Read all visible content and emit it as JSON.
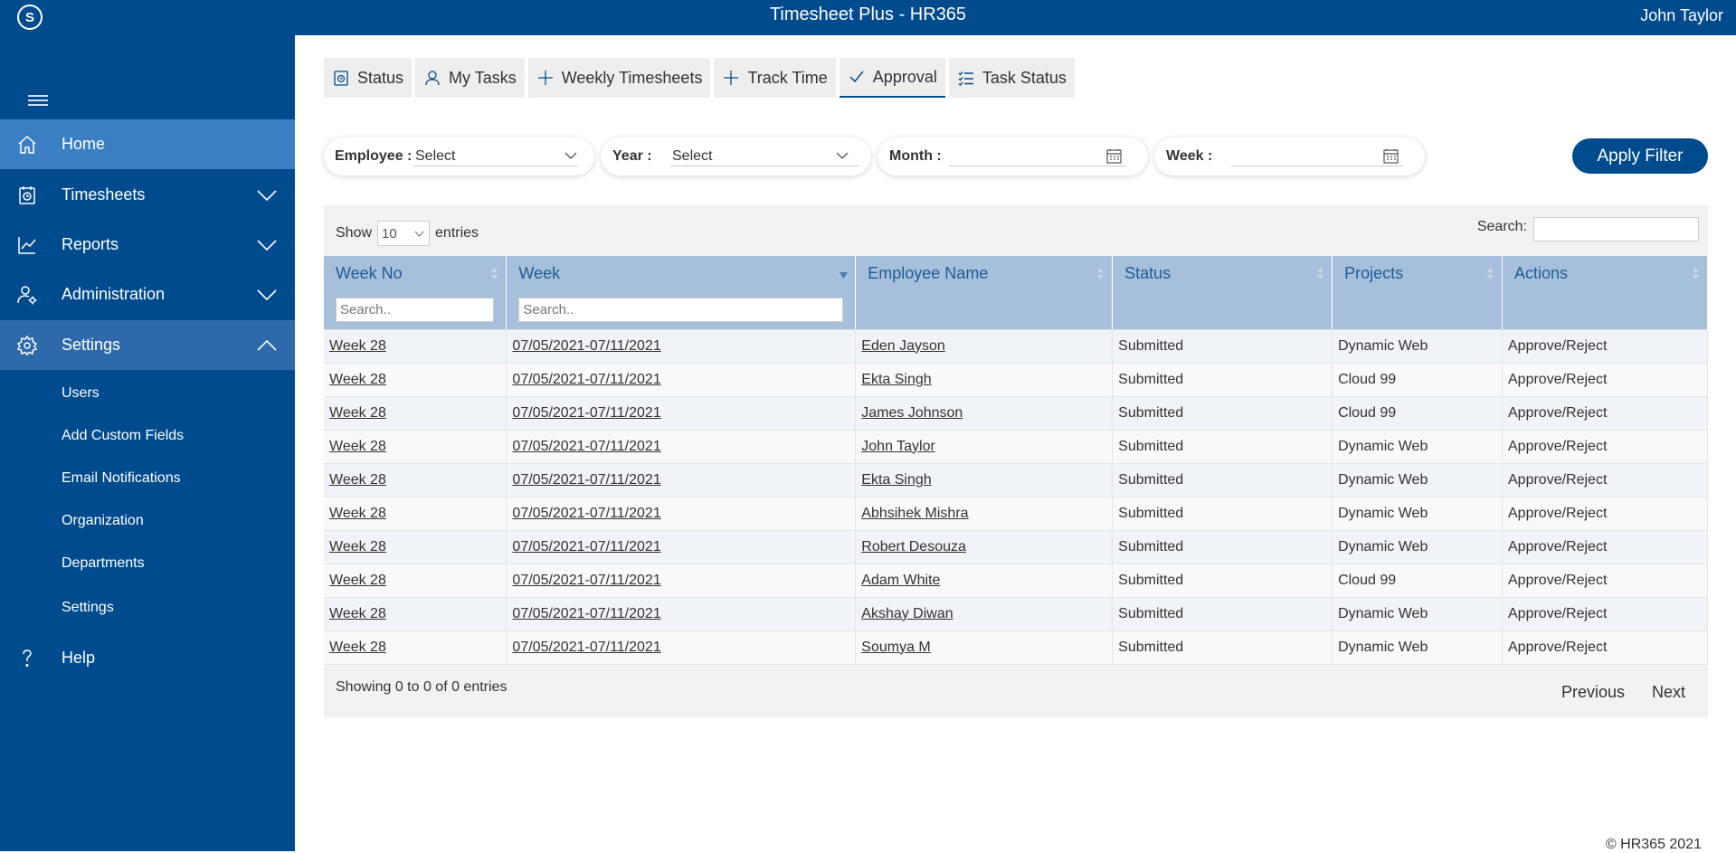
{
  "header": {
    "title": "Timesheet Plus - HR365",
    "user": "John Taylor",
    "logo_letter": "S"
  },
  "sidebar": {
    "items": [
      {
        "label": "Home",
        "icon": "home-icon"
      },
      {
        "label": "Timesheets",
        "icon": "timesheet-icon"
      },
      {
        "label": "Reports",
        "icon": "chart-icon"
      },
      {
        "label": "Administration",
        "icon": "admin-icon"
      },
      {
        "label": "Settings",
        "icon": "gear-icon"
      },
      {
        "label": "Help",
        "icon": "help-icon"
      }
    ],
    "settings_sub": [
      "Users",
      "Add Custom Fields",
      "Email Notifications",
      "Organization",
      "Departments",
      "Settings"
    ]
  },
  "tabs": [
    {
      "label": "Status",
      "icon": "status-icon"
    },
    {
      "label": "My Tasks",
      "icon": "user-icon"
    },
    {
      "label": "Weekly Timesheets",
      "icon": "plus-icon"
    },
    {
      "label": "Track Time",
      "icon": "plus-icon"
    },
    {
      "label": "Approval",
      "icon": "check-icon"
    },
    {
      "label": "Task Status",
      "icon": "checklist-icon"
    }
  ],
  "filters": {
    "employee_label": "Employee :",
    "employee_value": "Select",
    "year_label": "Year :",
    "year_value": "Select",
    "month_label": "Month :",
    "week_label": "Week :",
    "apply_label": "Apply Filter"
  },
  "table": {
    "show_label": "Show",
    "entries_value": "10",
    "entries_label": "entries",
    "search_label": "Search:",
    "column_search_placeholder": "Search..",
    "columns": [
      "Week No",
      "Week",
      "Employee Name",
      "Status",
      "Projects",
      "Actions"
    ],
    "rows": [
      [
        "Week 28",
        "07/05/2021-07/11/2021",
        "Eden Jayson",
        "Submitted",
        "Dynamic Web",
        "Approve/Reject"
      ],
      [
        "Week 28",
        "07/05/2021-07/11/2021",
        "Ekta Singh",
        "Submitted",
        "Cloud 99",
        "Approve/Reject"
      ],
      [
        "Week 28",
        "07/05/2021-07/11/2021",
        "James Johnson",
        "Submitted",
        "Cloud 99",
        "Approve/Reject"
      ],
      [
        "Week 28",
        "07/05/2021-07/11/2021",
        "John Taylor",
        "Submitted",
        "Dynamic Web",
        "Approve/Reject"
      ],
      [
        "Week 28",
        "07/05/2021-07/11/2021",
        "Ekta Singh",
        "Submitted",
        "Dynamic Web",
        "Approve/Reject"
      ],
      [
        "Week 28",
        "07/05/2021-07/11/2021",
        "Abhsihek Mishra",
        "Submitted",
        "Dynamic Web",
        "Approve/Reject"
      ],
      [
        "Week 28",
        "07/05/2021-07/11/2021",
        "Robert Desouza",
        "Submitted",
        "Dynamic Web",
        "Approve/Reject"
      ],
      [
        "Week 28",
        "07/05/2021-07/11/2021",
        "Adam White",
        "Submitted",
        "Cloud 99",
        "Approve/Reject"
      ],
      [
        "Week 28",
        "07/05/2021-07/11/2021",
        "Akshay Diwan",
        "Submitted",
        "Dynamic Web",
        "Approve/Reject"
      ],
      [
        "Week 28",
        "07/05/2021-07/11/2021",
        "Soumya M",
        "Submitted",
        "Dynamic Web",
        "Approve/Reject"
      ]
    ],
    "info": "Showing 0 to 0 of 0 entries",
    "previous": "Previous",
    "next": "Next"
  },
  "footer": "© HR365 2021",
  "colors": {
    "brand": "#004b8d",
    "active_nav": "#3a7fc4",
    "table_header": "#a6c0dc"
  }
}
